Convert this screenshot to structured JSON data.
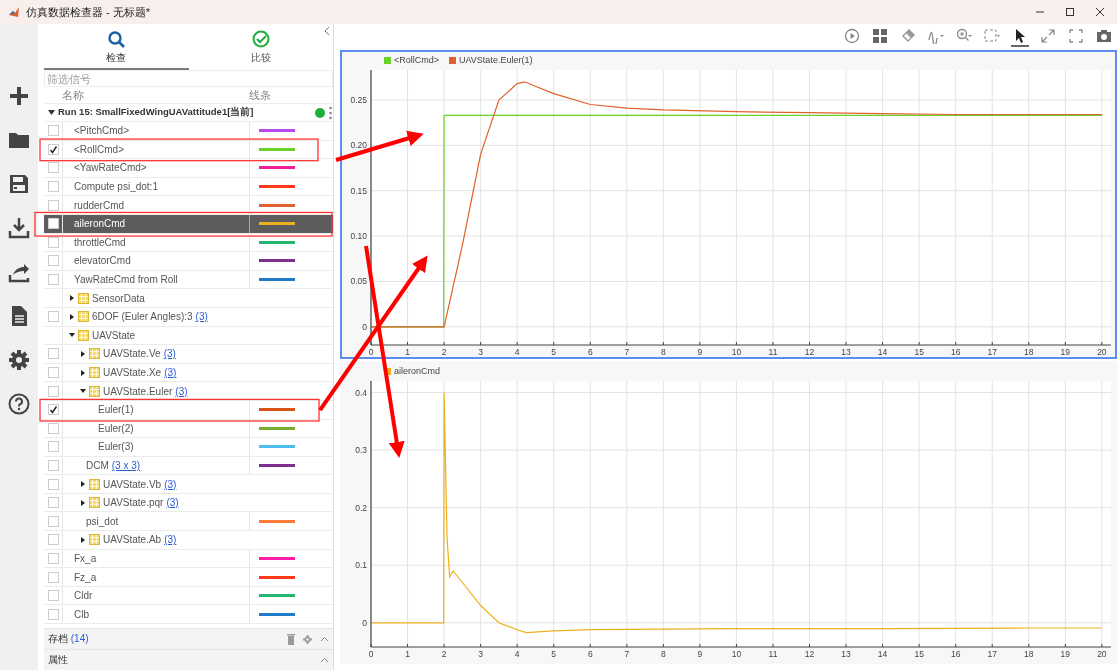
{
  "window": {
    "title": "仿真数据检查器 - 无标题*"
  },
  "tabs": [
    {
      "label": "检查",
      "kind": "inspect",
      "selected": true
    },
    {
      "label": "比较",
      "kind": "compare",
      "selected": false
    }
  ],
  "filter": {
    "placeholder": "筛选信号"
  },
  "columns": [
    "名称",
    "线条"
  ],
  "run": {
    "label": "Run 15: SmallFixedWingUAVattitude1[当前]",
    "expanded": true,
    "rows": [
      {
        "kind": "signal",
        "label": "<PitchCmd>",
        "checked": false,
        "selected": false,
        "color": "#b947f0"
      },
      {
        "kind": "signal",
        "label": "<RollCmd>",
        "checked": true,
        "selected": false,
        "color": "#6ad02a"
      },
      {
        "kind": "signal",
        "label": "<YawRateCmd>",
        "checked": false,
        "selected": false,
        "color": "#f0209a"
      },
      {
        "kind": "signal",
        "label": "Compute psi_dot:1",
        "checked": false,
        "selected": false,
        "color": "#ff3a1a"
      },
      {
        "kind": "signal",
        "label": "rudderCmd",
        "checked": false,
        "selected": false,
        "color": "#e0612b"
      },
      {
        "kind": "signal",
        "label": "aileronCmd",
        "checked": false,
        "selected": true,
        "color": "#edb120"
      },
      {
        "kind": "signal",
        "label": "throttleCmd",
        "checked": false,
        "selected": false,
        "color": "#25b56e"
      },
      {
        "kind": "signal",
        "label": "elevatorCmd",
        "checked": false,
        "selected": false,
        "color": "#7e2f8e"
      },
      {
        "kind": "signal",
        "label": "YawRateCmd from Roll",
        "checked": false,
        "selected": false,
        "color": "#1f78c8"
      },
      {
        "kind": "group",
        "label": "SensorData",
        "expanded": false,
        "selected": false
      },
      {
        "kind": "group",
        "label": "6DOF (Euler Angles):3",
        "count": "(3)",
        "checked": false,
        "expanded": false,
        "selected": false
      },
      {
        "kind": "group",
        "label": "UAVState",
        "expanded": true,
        "selected": false,
        "children": [
          {
            "kind": "group",
            "label": "UAVState.Ve",
            "count": "(3)",
            "checked": false,
            "expanded": false,
            "selected": false
          },
          {
            "kind": "group",
            "label": "UAVState.Xe",
            "count": "(3)",
            "checked": false,
            "expanded": false,
            "selected": false
          },
          {
            "kind": "group",
            "label": "UAVState.Euler",
            "count": "(3)",
            "checked": false,
            "expanded": true,
            "selected": false,
            "children": [
              {
                "kind": "signal",
                "label": "Euler(1)",
                "checked": true,
                "selected": false,
                "color": "#d95319"
              },
              {
                "kind": "signal",
                "label": "Euler(2)",
                "checked": false,
                "selected": false,
                "color": "#77ac30"
              },
              {
                "kind": "signal",
                "label": "Euler(3)",
                "checked": false,
                "selected": false,
                "color": "#4dbeee"
              }
            ]
          },
          {
            "kind": "signal",
            "label": "DCM",
            "count": "(3 x 3)",
            "checked": false,
            "selected": false,
            "color": "#7e2f8e"
          },
          {
            "kind": "group",
            "label": "UAVState.Vb",
            "count": "(3)",
            "checked": false,
            "expanded": false,
            "selected": false
          },
          {
            "kind": "group",
            "label": "UAVState.pqr",
            "count": "(3)",
            "checked": false,
            "expanded": false,
            "selected": false
          },
          {
            "kind": "signal",
            "label": "psi_dot",
            "checked": false,
            "selected": false,
            "color": "#ff7a3a"
          },
          {
            "kind": "group",
            "label": "UAVState.Ab",
            "count": "(3)",
            "checked": false,
            "expanded": false,
            "selected": false
          }
        ]
      },
      {
        "kind": "signal",
        "label": "Fx_a",
        "checked": false,
        "selected": false,
        "color": "#ff1aa8"
      },
      {
        "kind": "signal",
        "label": "Fz_a",
        "checked": false,
        "selected": false,
        "color": "#ff3a1a"
      },
      {
        "kind": "signal",
        "label": "Cldr",
        "checked": false,
        "selected": false,
        "color": "#25b56e"
      },
      {
        "kind": "signal",
        "label": "Clb",
        "checked": false,
        "selected": false,
        "color": "#1f78c8"
      }
    ]
  },
  "archive": {
    "label": "存档",
    "count": "(14)"
  },
  "properties": {
    "label": "属性"
  },
  "toolbar": [
    {
      "kind": "play",
      "selected": false
    },
    {
      "kind": "layout",
      "selected": false
    },
    {
      "kind": "eraser",
      "selected": false
    },
    {
      "kind": "wave",
      "selected": false
    },
    {
      "kind": "zoom",
      "selected": false
    },
    {
      "kind": "fit",
      "selected": false
    },
    {
      "kind": "cursor",
      "selected": true
    },
    {
      "kind": "expand",
      "selected": false
    },
    {
      "kind": "fullscreen",
      "selected": false
    },
    {
      "kind": "camera",
      "selected": false
    }
  ],
  "plots": [
    {
      "selected": true,
      "chart_data": {
        "type": "line",
        "grid": true,
        "x": [
          0,
          1,
          1.99,
          2,
          2.5,
          3,
          3.5,
          4,
          4.2,
          4.5,
          5,
          6,
          7,
          8,
          10,
          12,
          14,
          16,
          18,
          20
        ],
        "xlim": [
          0,
          20.25
        ],
        "ylim": [
          -0.02,
          0.283
        ],
        "xticks": [
          0,
          1,
          2,
          3,
          4,
          5,
          6,
          7,
          8,
          9,
          10,
          11,
          12,
          13,
          14,
          15,
          16,
          17,
          18,
          19,
          20
        ],
        "yticks": [
          0,
          0.05,
          {
            "value": 0.1,
            "label": "0.10"
          },
          0.15,
          {
            "value": 0.2,
            "label": "0.20"
          },
          0.25
        ],
        "series": [
          {
            "name": "<RollCmd>",
            "color": "#6ad02a",
            "values": [
              0,
              0,
              0,
              0.233,
              0.233,
              0.233,
              0.233,
              0.233,
              0.233,
              0.233,
              0.233,
              0.233,
              0.233,
              0.233,
              0.233,
              0.233,
              0.233,
              0.233,
              0.233,
              0.233
            ]
          },
          {
            "name": "UAVState.Euler(1)",
            "color": "#e0612b",
            "values": [
              0,
              0,
              0,
              0,
              0.09,
              0.19,
              0.25,
              0.268,
              0.27,
              0.265,
              0.257,
              0.245,
              0.241,
              0.239,
              0.237,
              0.236,
              0.235,
              0.234,
              0.234,
              0.234
            ]
          }
        ]
      }
    },
    {
      "selected": false,
      "chart_data": {
        "type": "line",
        "grid": true,
        "x": [
          0,
          1,
          1.99,
          2,
          2.08,
          2.15,
          2.25,
          2.5,
          3,
          3.5,
          4,
          4.25,
          5,
          6,
          8,
          10,
          14,
          18,
          20
        ],
        "xlim": [
          0,
          20.25
        ],
        "ylim": [
          -0.042,
          0.42
        ],
        "xticks": [
          0,
          1,
          2,
          3,
          4,
          5,
          6,
          7,
          8,
          9,
          10,
          11,
          12,
          13,
          14,
          15,
          16,
          17,
          18,
          19,
          20
        ],
        "yticks": [
          0,
          0.1,
          0.2,
          0.3,
          0.4
        ],
        "series": [
          {
            "name": "aileronCmd",
            "color": "#edb120",
            "values": [
              0,
              0,
              0,
              0.4,
              0.15,
              0.08,
              0.09,
              0.07,
              0.03,
              0,
              -0.012,
              -0.017,
              -0.014,
              -0.012,
              -0.011,
              -0.01,
              -0.01,
              -0.009,
              -0.009
            ]
          }
        ]
      }
    }
  ]
}
